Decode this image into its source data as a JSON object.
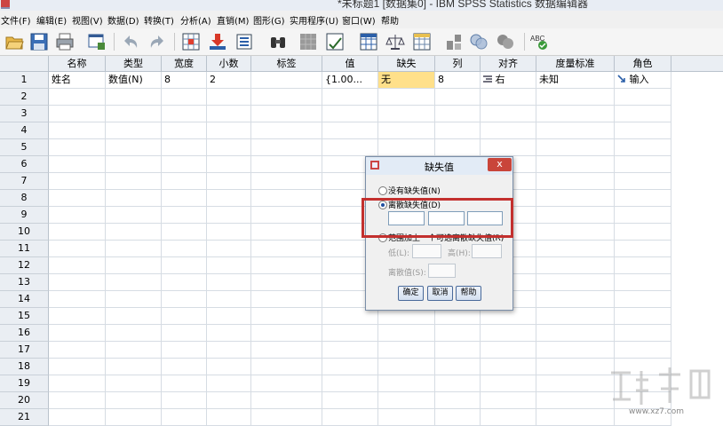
{
  "window": {
    "title": "*未标题1 [数据集0] - IBM SPSS Statistics 数据编辑器"
  },
  "menu": [
    {
      "label": "文件(F)"
    },
    {
      "label": "编辑(E)"
    },
    {
      "label": "视图(V)"
    },
    {
      "label": "数据(D)"
    },
    {
      "label": "转换(T)"
    },
    {
      "label": "分析(A)"
    },
    {
      "label": "直销(M)"
    },
    {
      "label": "图形(G)"
    },
    {
      "label": "实用程序(U)"
    },
    {
      "label": "窗口(W)"
    },
    {
      "label": "帮助"
    }
  ],
  "toolbar": {
    "icons": [
      "open-icon",
      "save-icon",
      "print-icon",
      "dialog-recall-icon",
      "undo-icon",
      "redo-icon",
      "goto-case-icon",
      "goto-variable-icon",
      "variables-icon",
      "find-icon",
      "insert-cases-icon",
      "insert-variable-icon",
      "split-file-icon",
      "weight-cases-icon",
      "select-cases-icon",
      "value-labels-icon",
      "use-sets-icon",
      "show-all-variables-icon",
      "spell-check-icon"
    ],
    "spell_label": "ABC"
  },
  "grid": {
    "headers": [
      "名称",
      "类型",
      "宽度",
      "小数",
      "标签",
      "值",
      "缺失",
      "列",
      "对齐",
      "度量标准",
      "角色"
    ],
    "row1": [
      "姓名",
      "数值(N)",
      "8",
      "2",
      "",
      "{1.00...",
      "无",
      "8",
      "右",
      "未知",
      "输入"
    ],
    "row_numbers": [
      "1",
      "2",
      "3",
      "4",
      "5",
      "6",
      "7",
      "8",
      "9",
      "10",
      "11",
      "12",
      "13",
      "14",
      "15",
      "16",
      "17",
      "18",
      "19",
      "20",
      "21"
    ]
  },
  "dialog": {
    "title": "缺失值",
    "close_label": "x",
    "option_none": "没有缺失值(N)",
    "option_discrete": "离散缺失值(D)",
    "option_range": "范围加上一个可选离散缺失值(R)",
    "low_label": "低(L):",
    "high_label": "高(H):",
    "discrete_value_label": "离散值(S):",
    "selected_option": "discrete",
    "buttons": {
      "ok": "确定",
      "cancel": "取消",
      "help": "帮助"
    }
  },
  "watermark": {
    "text": "www.xz7.com"
  },
  "colors": {
    "highlight": "#c3302e",
    "missing_cell_bg": "#ffe08a",
    "header_bg": "#eaeef3"
  }
}
